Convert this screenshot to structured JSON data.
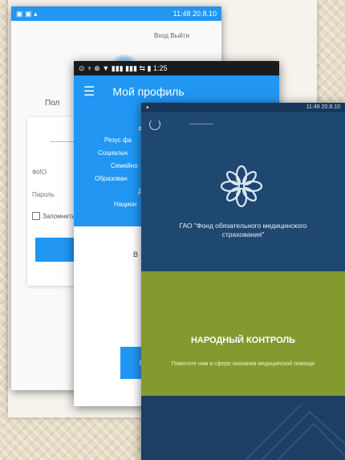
{
  "screen1": {
    "status": "11:48 20.8.10",
    "top_links": "Вход Выйти",
    "title": "Пол",
    "fields": [
      "ФИО",
      "Пароль"
    ],
    "checkbox_label": "Запомнить"
  },
  "screen2": {
    "status": "1:25",
    "title": "Мой профиль",
    "rows": [
      "Ф",
      "Резус фа",
      "Социальн",
      "Семейно",
      "Образован",
      "Д",
      "Национ"
    ],
    "section": "В",
    "button_label": "ВО"
  },
  "screen3": {
    "status": "11:48 20.8.10",
    "small_text": "──────",
    "org": "ГАО \"Фонд обязательного медицинского страхования\"",
    "green_title": "НАРОДНЫЙ КОНТРОЛЬ",
    "green_subtitle": "Помогите нам в сфере оказания медицинской помощи"
  }
}
